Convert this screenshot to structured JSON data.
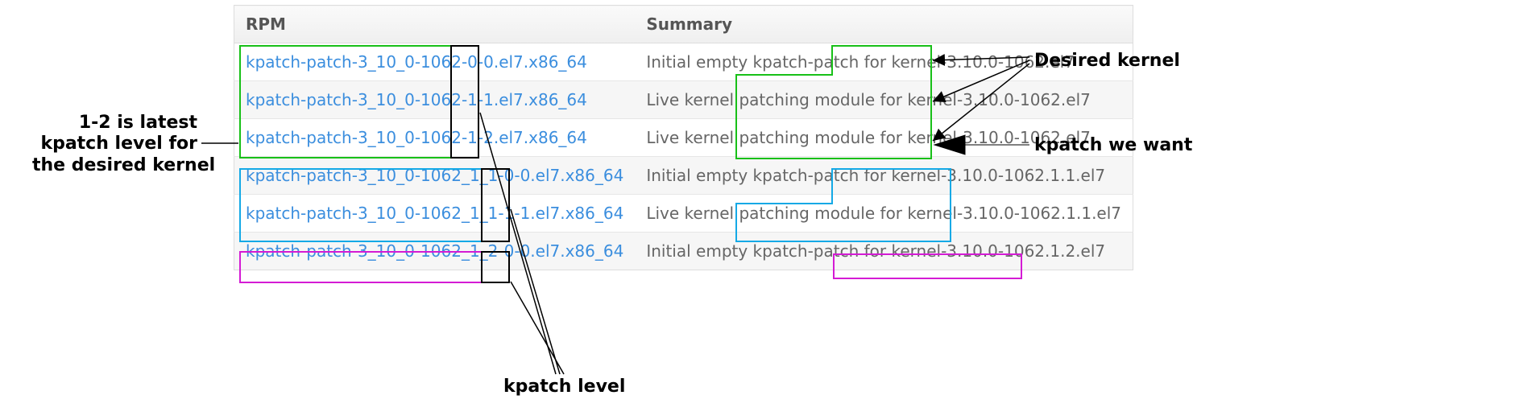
{
  "headers": {
    "rpm": "RPM",
    "summary": "Summary"
  },
  "rows": [
    {
      "rpm": "kpatch-patch-3_10_0-1062-0-0.el7.x86_64",
      "summary": "Initial empty kpatch-patch for kernel-3.10.0-1062.el7"
    },
    {
      "rpm": "kpatch-patch-3_10_0-1062-1-1.el7.x86_64",
      "summary": "Live kernel patching module for kernel-3.10.0-1062.el7"
    },
    {
      "rpm": "kpatch-patch-3_10_0-1062-1-2.el7.x86_64",
      "summary": "Live kernel patching module for kernel-3.10.0-1062.el7"
    },
    {
      "rpm": "kpatch-patch-3_10_0-1062_1_1-0-0.el7.x86_64",
      "summary": "Initial empty kpatch-patch for kernel-3.10.0-1062.1.1.el7"
    },
    {
      "rpm": "kpatch-patch-3_10_0-1062_1_1-1-1.el7.x86_64",
      "summary": "Live kernel patching module for kernel-3.10.0-1062.1.1.el7"
    },
    {
      "rpm": "kpatch-patch-3_10_0-1062_1_2-0-0.el7.x86_64",
      "summary": "Initial empty kpatch-patch for kernel-3.10.0-1062.1.2.el7"
    }
  ],
  "annot": {
    "latest": "1-2 is latest\nkpatch level for\nthe desired kernel",
    "desired": "Desired kernel",
    "want": "kpatch we want",
    "level": "kpatch level"
  }
}
